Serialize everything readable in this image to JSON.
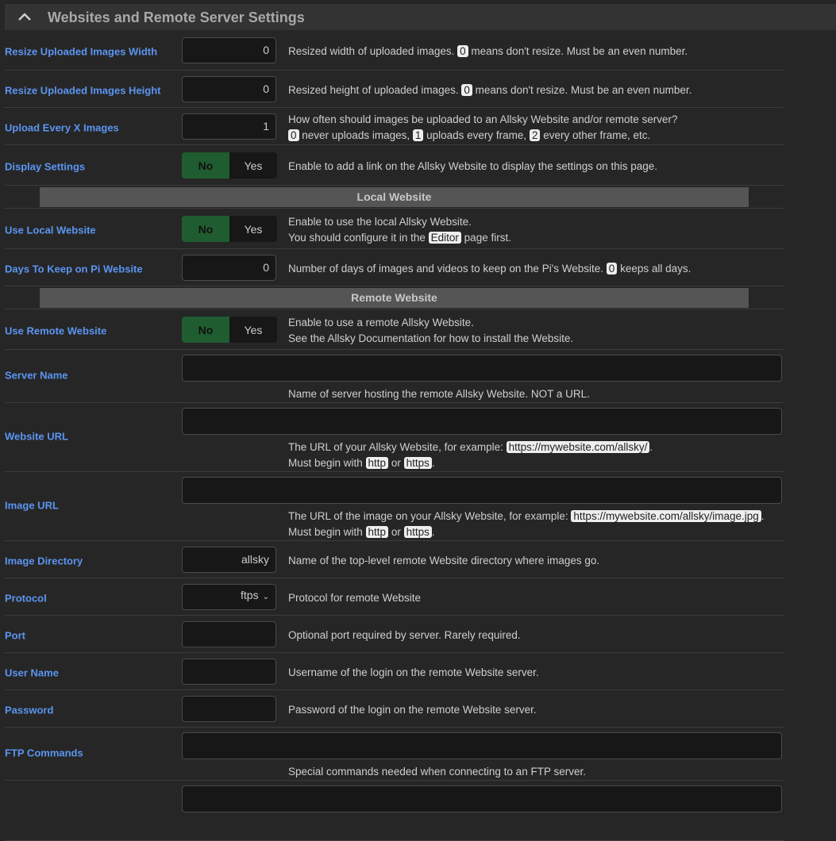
{
  "panel": {
    "title": "Websites and Remote Server Settings",
    "collapse_icon": "chevron-up-icon"
  },
  "colors": {
    "label": "#5b95f2",
    "toggle_on": "#1f5c30",
    "background": "#262626"
  },
  "rows": [
    {
      "type": "number",
      "label": "Resize Uploaded Images Width",
      "value": "0",
      "desc": [
        [
          "Resized width of uploaded images. ",
          {
            "c": "0"
          },
          " means don't resize. Must be an even number."
        ]
      ]
    },
    {
      "type": "number",
      "label": "Resize Uploaded Images Height",
      "value": "0",
      "desc": [
        [
          "Resized height of uploaded images. ",
          {
            "c": "0"
          },
          " means don't resize. Must be an even number."
        ]
      ]
    },
    {
      "type": "number",
      "label": "Upload Every X Images",
      "value": "1",
      "desc": [
        [
          "How often should images be uploaded to an Allsky Website and/or remote server?"
        ],
        [
          {
            "c": "0"
          },
          " never uploads images, ",
          {
            "c": "1"
          },
          " uploads every frame, ",
          {
            "c": "2"
          },
          " every other frame, etc."
        ]
      ]
    },
    {
      "type": "toggle",
      "label": "Display Settings",
      "no": "No",
      "yes": "Yes",
      "desc": [
        [
          "Enable to add a link on the Allsky Website to display the settings on this page."
        ]
      ]
    },
    {
      "type": "section",
      "label": "Local Website"
    },
    {
      "type": "toggle",
      "label": "Use Local Website",
      "no": "No",
      "yes": "Yes",
      "desc": [
        [
          "Enable to use the local Allsky Website."
        ],
        [
          "You should configure it in the ",
          {
            "c": "Editor"
          },
          " page first."
        ]
      ]
    },
    {
      "type": "number",
      "label": "Days To Keep on Pi Website",
      "value": "0",
      "desc": [
        [
          "Number of days of images and videos to keep on the Pi's Website. ",
          {
            "c": "0"
          },
          " keeps all days."
        ]
      ]
    },
    {
      "type": "section",
      "label": "Remote Website"
    },
    {
      "type": "toggle",
      "label": "Use Remote Website",
      "no": "No",
      "yes": "Yes",
      "desc": [
        [
          "Enable to use a remote Allsky Website."
        ],
        [
          "See the Allsky Documentation for how to install the Website."
        ]
      ]
    },
    {
      "type": "wide",
      "label": "Server Name",
      "value": "",
      "desc": [
        [
          "Name of server hosting the remote Allsky Website. NOT a URL."
        ]
      ]
    },
    {
      "type": "wide",
      "label": "Website URL",
      "value": "",
      "desc": [
        [
          "The URL of your Allsky Website, for example: ",
          {
            "c": "https://mywebsite.com/allsky/"
          },
          "."
        ],
        [
          "Must begin with ",
          {
            "c": "http"
          },
          " or ",
          {
            "c": "https"
          },
          "."
        ]
      ]
    },
    {
      "type": "wide",
      "label": "Image URL",
      "value": "",
      "desc": [
        [
          "The URL of the image on your Allsky Website, for example: ",
          {
            "c": "https://mywebsite.com/allsky/image.jpg"
          },
          "."
        ],
        [
          "Must begin with ",
          {
            "c": "http"
          },
          " or ",
          {
            "c": "https"
          },
          "."
        ]
      ]
    },
    {
      "type": "text",
      "label": "Image Directory",
      "value": "allsky",
      "desc": [
        [
          "Name of the top-level remote Website directory where images go."
        ]
      ]
    },
    {
      "type": "select",
      "label": "Protocol",
      "value": "ftps",
      "desc": [
        [
          "Protocol for remote Website"
        ]
      ]
    },
    {
      "type": "text",
      "label": "Port",
      "value": "",
      "desc": [
        [
          "Optional port required by server. Rarely required."
        ]
      ]
    },
    {
      "type": "text",
      "label": "User Name",
      "value": "",
      "desc": [
        [
          "Username of the login on the remote Website server."
        ]
      ]
    },
    {
      "type": "text",
      "label": "Password",
      "value": "",
      "desc": [
        [
          "Password of the login on the remote Website server."
        ]
      ]
    },
    {
      "type": "wide",
      "label": "FTP Commands",
      "value": "",
      "desc": [
        [
          "Special commands needed when connecting to an FTP server."
        ]
      ]
    },
    {
      "type": "wide",
      "label": "",
      "value": "",
      "desc": []
    }
  ]
}
